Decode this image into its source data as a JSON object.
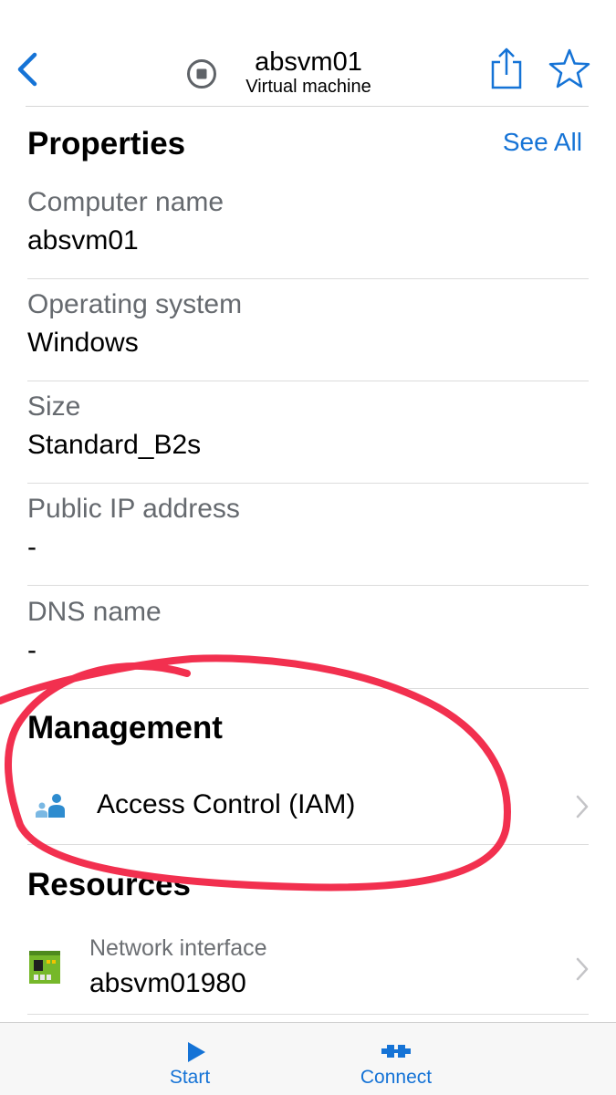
{
  "header": {
    "title": "absvm01",
    "subtitle": "Virtual machine",
    "icons": {
      "back": "chevron-left-icon",
      "status": "stop-circle-icon",
      "share": "share-icon",
      "favorite": "star-icon"
    }
  },
  "properties": {
    "title": "Properties",
    "see_all": "See All",
    "rows": [
      {
        "label": "Computer name",
        "value": "absvm01"
      },
      {
        "label": "Operating system",
        "value": "Windows"
      },
      {
        "label": "Size",
        "value": "Standard_B2s"
      },
      {
        "label": "Public IP address",
        "value": "-"
      },
      {
        "label": "DNS name",
        "value": "-"
      }
    ]
  },
  "management": {
    "title": "Management",
    "items": [
      {
        "label": "Access Control (IAM)",
        "icon": "users-icon"
      }
    ]
  },
  "resources": {
    "title": "Resources",
    "items": [
      {
        "type": "Network interface",
        "name": "absvm01980",
        "icon": "network-card-icon"
      }
    ]
  },
  "toolbar": {
    "start_label": "Start",
    "connect_label": "Connect"
  },
  "colors": {
    "accent": "#1573d6",
    "annotation": "#f2304f",
    "secondary_text": "#666a6f"
  }
}
